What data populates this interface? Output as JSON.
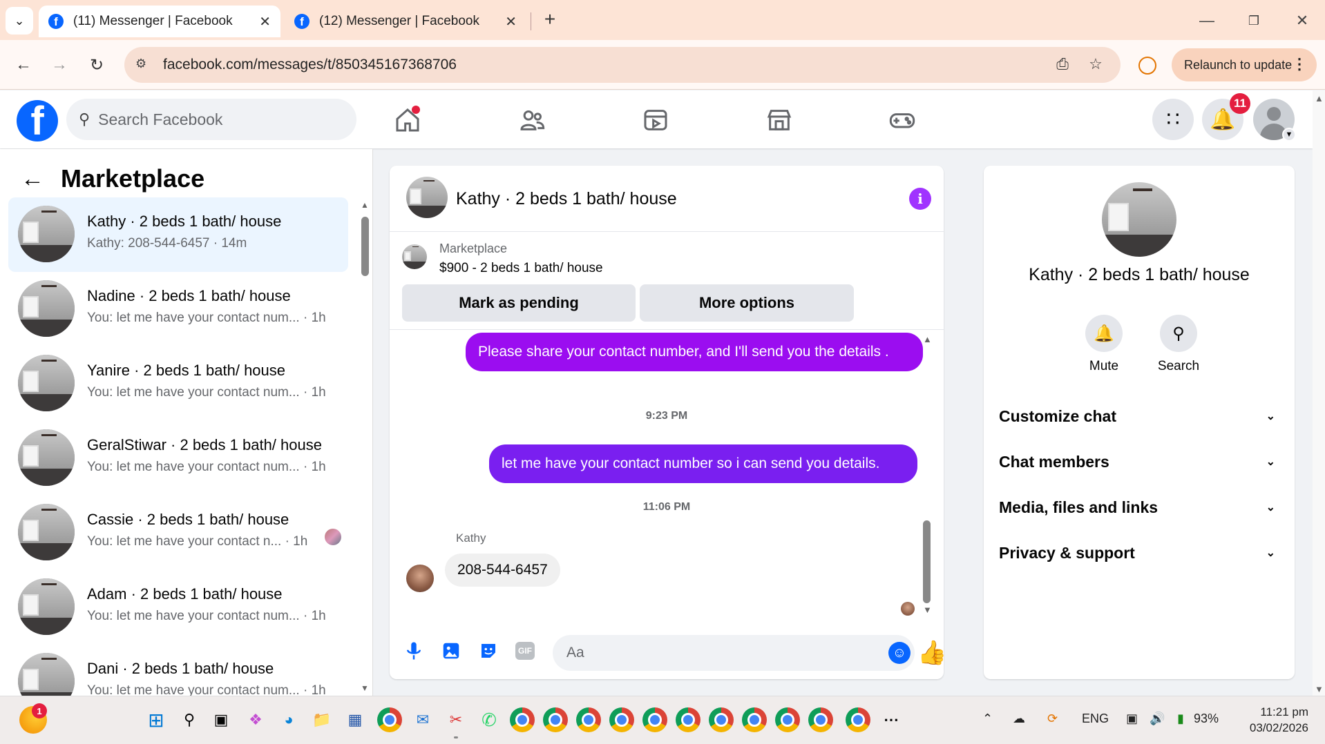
{
  "browser": {
    "tabs": [
      {
        "title": "(11) Messenger | Facebook",
        "active": true
      },
      {
        "title": "(12) Messenger | Facebook",
        "active": false
      }
    ],
    "url": "facebook.com/messages/t/850345167368706",
    "relaunch_label": "Relaunch to update"
  },
  "fb_header": {
    "search_placeholder": "Search Facebook",
    "notification_count": "11"
  },
  "left_panel": {
    "title": "Marketplace",
    "chats": [
      {
        "name": "Kathy · 2 beds 1 bath/ house",
        "preview": "Kathy: 208-544-6457 · 14m",
        "selected": true
      },
      {
        "name": "Nadine · 2 beds 1 bath/ house",
        "preview": "You: let me have your contact num... · 1h"
      },
      {
        "name": "Yanire · 2 beds 1 bath/ house",
        "preview": "You: let me have your contact num... · 1h"
      },
      {
        "name": "GeralStiwar · 2 beds 1 bath/ house",
        "preview": "You: let me have your contact num... · 1h"
      },
      {
        "name": "Cassie · 2 beds 1 bath/ house",
        "preview": "You: let me have your contact n...  · 1h"
      },
      {
        "name": "Adam · 2 beds 1 bath/ house",
        "preview": "You: let me have your contact num... · 1h"
      },
      {
        "name": "Dani · 2 beds 1 bath/ house",
        "preview": "You: let me have your contact num... · 1h"
      }
    ]
  },
  "conversation": {
    "title": "Kathy · 2 beds 1 bath/ house",
    "marketplace_label": "Marketplace",
    "listing": "$900 - 2 beds 1 bath/ house",
    "mark_pending_label": "Mark as pending",
    "more_options_label": "More options",
    "messages": [
      {
        "from": "me",
        "text": "Please share your contact number, and I'll send you the details ."
      },
      {
        "type": "timestamp",
        "text": "9:23 PM"
      },
      {
        "from": "me",
        "text": "let me have your contact number so i can send you details."
      },
      {
        "type": "timestamp",
        "text": "11:06 PM"
      },
      {
        "from": "Kathy",
        "sender_label": "Kathy",
        "text": "208-544-6457"
      }
    ],
    "input_placeholder": "Aa",
    "accent_color": "#8a00ff"
  },
  "right_panel": {
    "name": "Kathy · 2 beds 1 bath/ house",
    "actions": [
      {
        "label": "Mute",
        "icon": "bell-icon"
      },
      {
        "label": "Search",
        "icon": "search-icon"
      }
    ],
    "sections": [
      "Customize chat",
      "Chat members",
      "Media, files and links",
      "Privacy & support"
    ]
  },
  "taskbar": {
    "weather_badge": "1",
    "language": "ENG",
    "battery": "93%",
    "time": "11:21 pm",
    "date": "03/02/2026"
  }
}
